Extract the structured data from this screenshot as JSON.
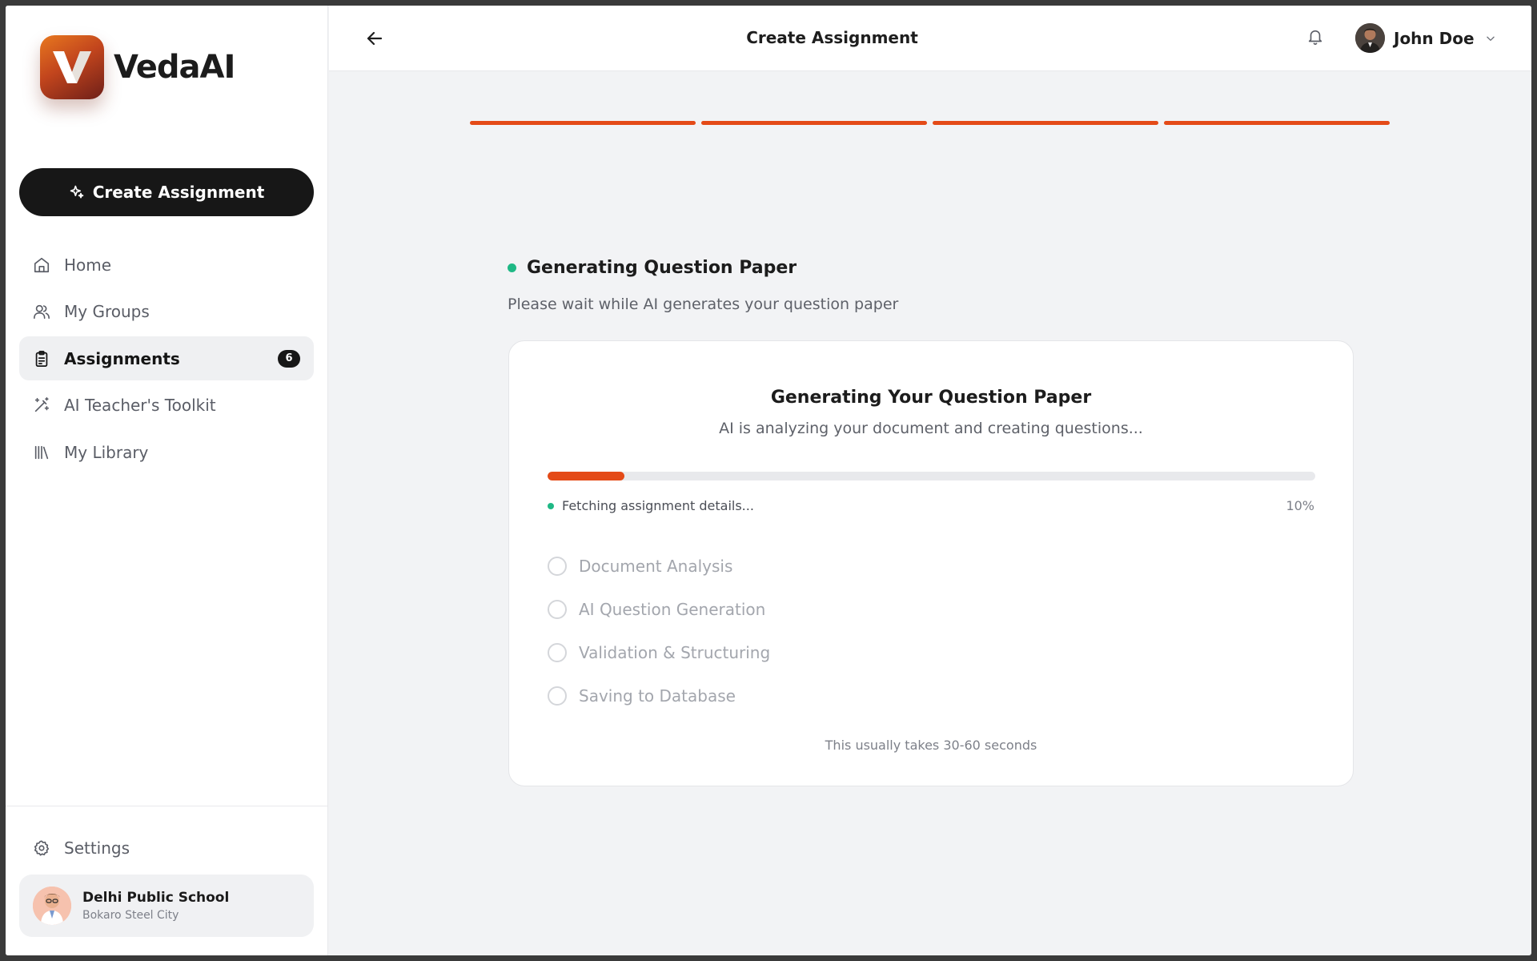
{
  "brand": {
    "name": "VedaAI"
  },
  "sidebar": {
    "create_label": "Create Assignment",
    "items": [
      {
        "label": "Home",
        "icon": "home-icon"
      },
      {
        "label": "My Groups",
        "icon": "users-icon"
      },
      {
        "label": "Assignments",
        "icon": "clipboard-icon",
        "badge": "6",
        "active": true
      },
      {
        "label": "AI Teacher's Toolkit",
        "icon": "magic-wand-icon"
      },
      {
        "label": "My Library",
        "icon": "library-icon"
      }
    ],
    "settings_label": "Settings",
    "school": {
      "name": "Delhi Public School",
      "city": "Bokaro Steel City"
    }
  },
  "header": {
    "title": "Create Assignment",
    "user_name": "John Doe"
  },
  "stepper": {
    "total_steps": 4,
    "completed_steps": 4,
    "accent": "#e44a17"
  },
  "main": {
    "heading": "Generating Question Paper",
    "subheading": "Please wait while AI generates your question paper",
    "card": {
      "title": "Generating Your Question Paper",
      "subtitle": "AI is analyzing your document and creating questions...",
      "progress_percent": 10,
      "progress_label": "10%",
      "status": "Fetching assignment details...",
      "steps": [
        {
          "label": "Document Analysis",
          "done": false
        },
        {
          "label": "AI Question Generation",
          "done": false
        },
        {
          "label": "Validation & Structuring",
          "done": false
        },
        {
          "label": "Saving to Database",
          "done": false
        }
      ],
      "footer": "This usually takes 30-60 seconds"
    }
  },
  "colors": {
    "accent": "#e44a17",
    "status_green": "#1fb885",
    "dark": "#171717"
  }
}
